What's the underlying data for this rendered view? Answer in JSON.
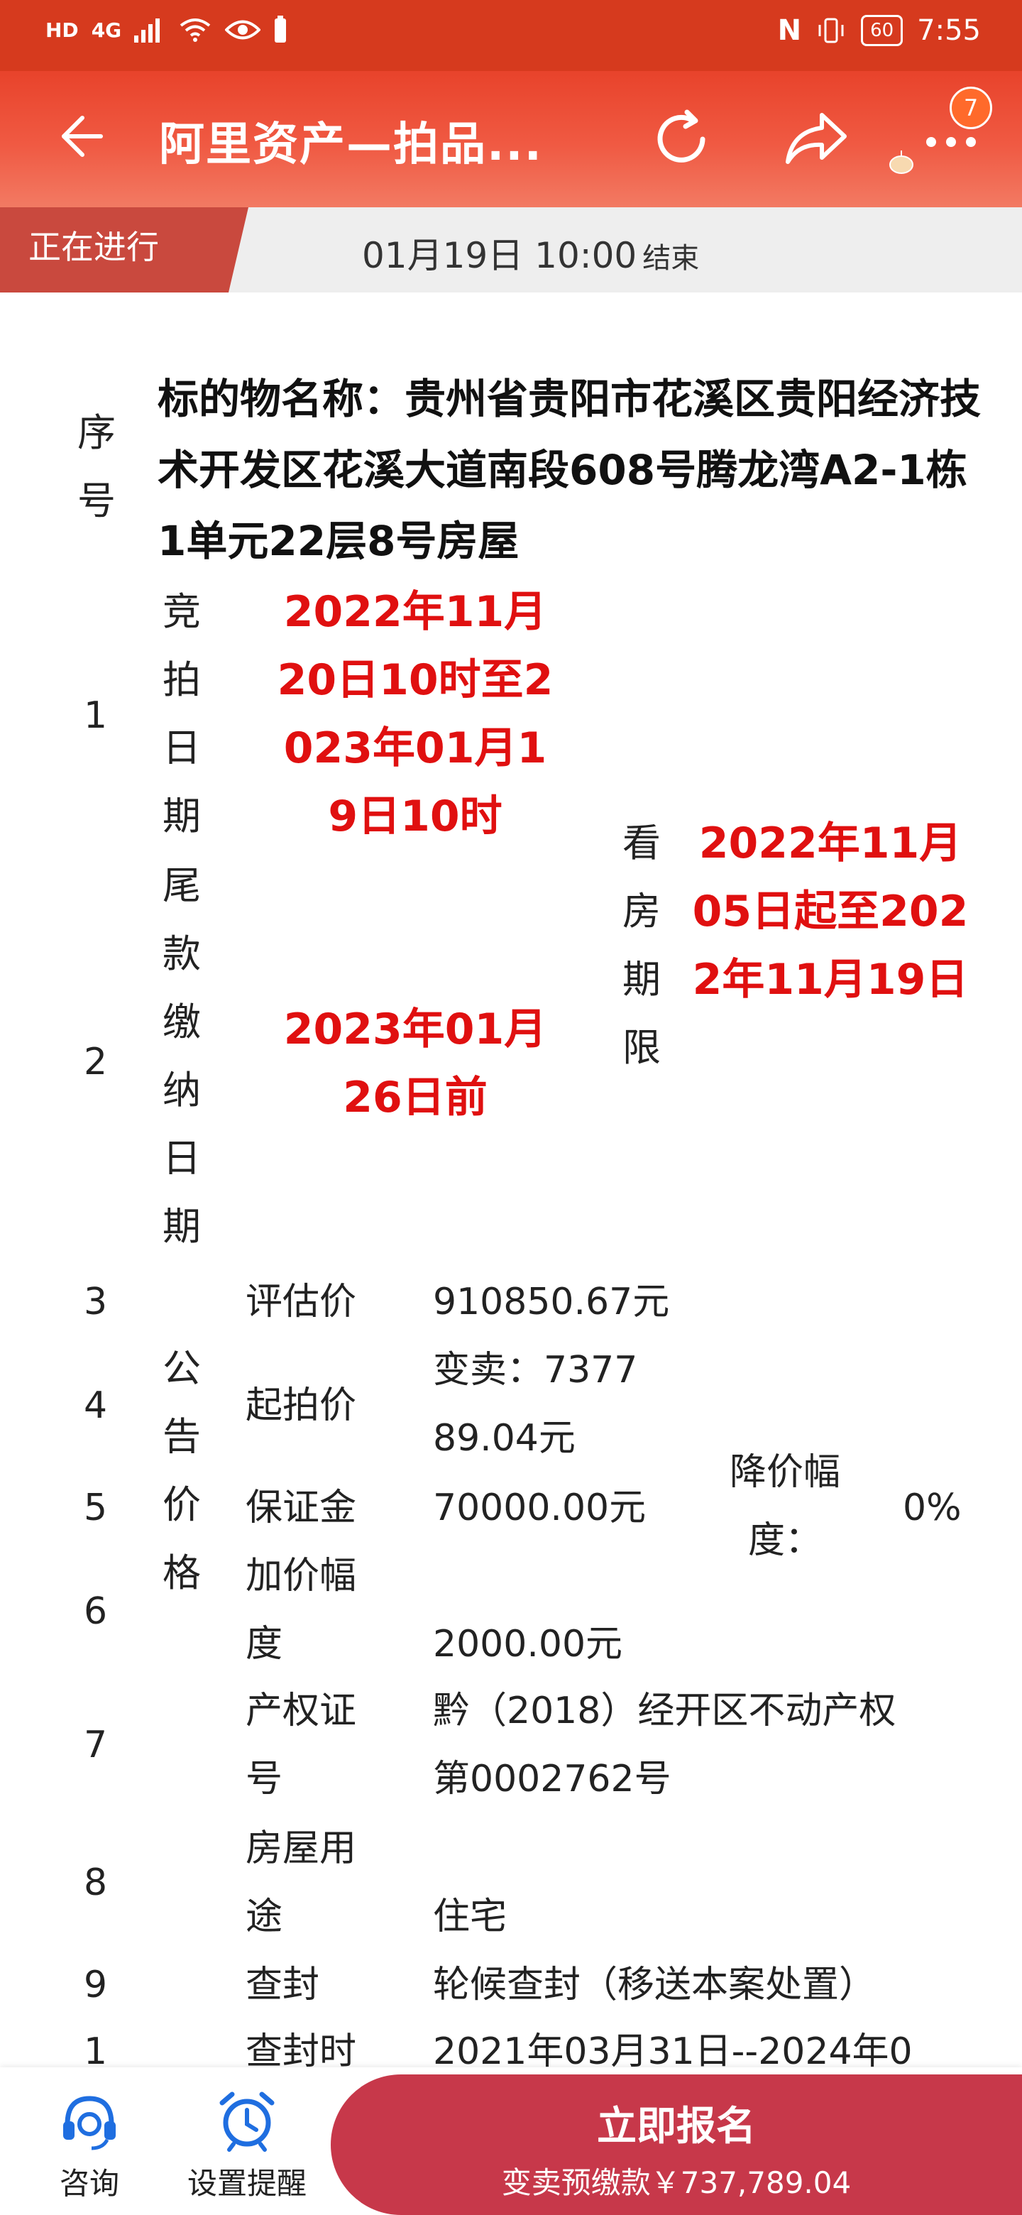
{
  "status_bar": {
    "left_icons": [
      "HD",
      "4G",
      "signal-icon",
      "wifi-icon",
      "eye-icon",
      "battery-saver-icon"
    ],
    "nfc": "N",
    "battery": "60",
    "time": "7:55"
  },
  "app_bar": {
    "title": "阿里资产—拍品...",
    "badge_count": "7"
  },
  "auction_status": {
    "tag": "正在进行",
    "end_time": "01月19日 10:00",
    "end_suffix": "结束"
  },
  "table": {
    "col_seq_header": "序号",
    "title": "标的物名称：贵州省贵阳市花溪区贵阳经济技术开发区花溪大道南段608号腾龙湾A2-1栋1单元22层8号房屋",
    "rows": [
      {
        "seq": "1",
        "label": "竞拍日期",
        "value": "2022年11月20日10时至2023年01月19日10时"
      },
      {
        "seq": "2",
        "label": "尾款缴纳日期",
        "value": "2023年01月26日前"
      }
    ],
    "viewing": {
      "label": "看房期限",
      "value": "2022年11月05日起至2022年11月19日"
    },
    "price_group_label": "公告价格",
    "price_rows": [
      {
        "seq": "3",
        "label": "评估价",
        "value": "910850.67元"
      },
      {
        "seq": "4",
        "label": "起拍价",
        "value": "变卖：737789.04元"
      },
      {
        "seq": "5",
        "label": "保证金",
        "value": "70000.00元"
      },
      {
        "seq": "6",
        "label": "加价幅度",
        "value": "2000.00元"
      }
    ],
    "discount_label": "降价幅度：",
    "discount_value": "0%",
    "other_rows": [
      {
        "seq": "7",
        "label": "产权证号",
        "value": "黔（2018）经开区不动产权第0002762号"
      },
      {
        "seq": "8",
        "label": "房屋用途",
        "value": "住宅"
      },
      {
        "seq": "9",
        "label": "查封",
        "value": "轮候查封（移送本案处置）"
      },
      {
        "seq": "1",
        "label": "查封时",
        "value": "2021年03月31日--2024年0"
      }
    ]
  },
  "bottom_bar": {
    "consult": "咨询",
    "reminder": "设置提醒",
    "cta_main": "立即报名",
    "cta_sub": "变卖预缴款￥737,789.04"
  },
  "colors": {
    "status_bar": "#d63a1e",
    "app_bar": "#e8432b",
    "live_tag": "#c9493e",
    "cta": "#c7384a",
    "highlight_red": "#e01010",
    "icon_blue": "#1f6ee0"
  }
}
